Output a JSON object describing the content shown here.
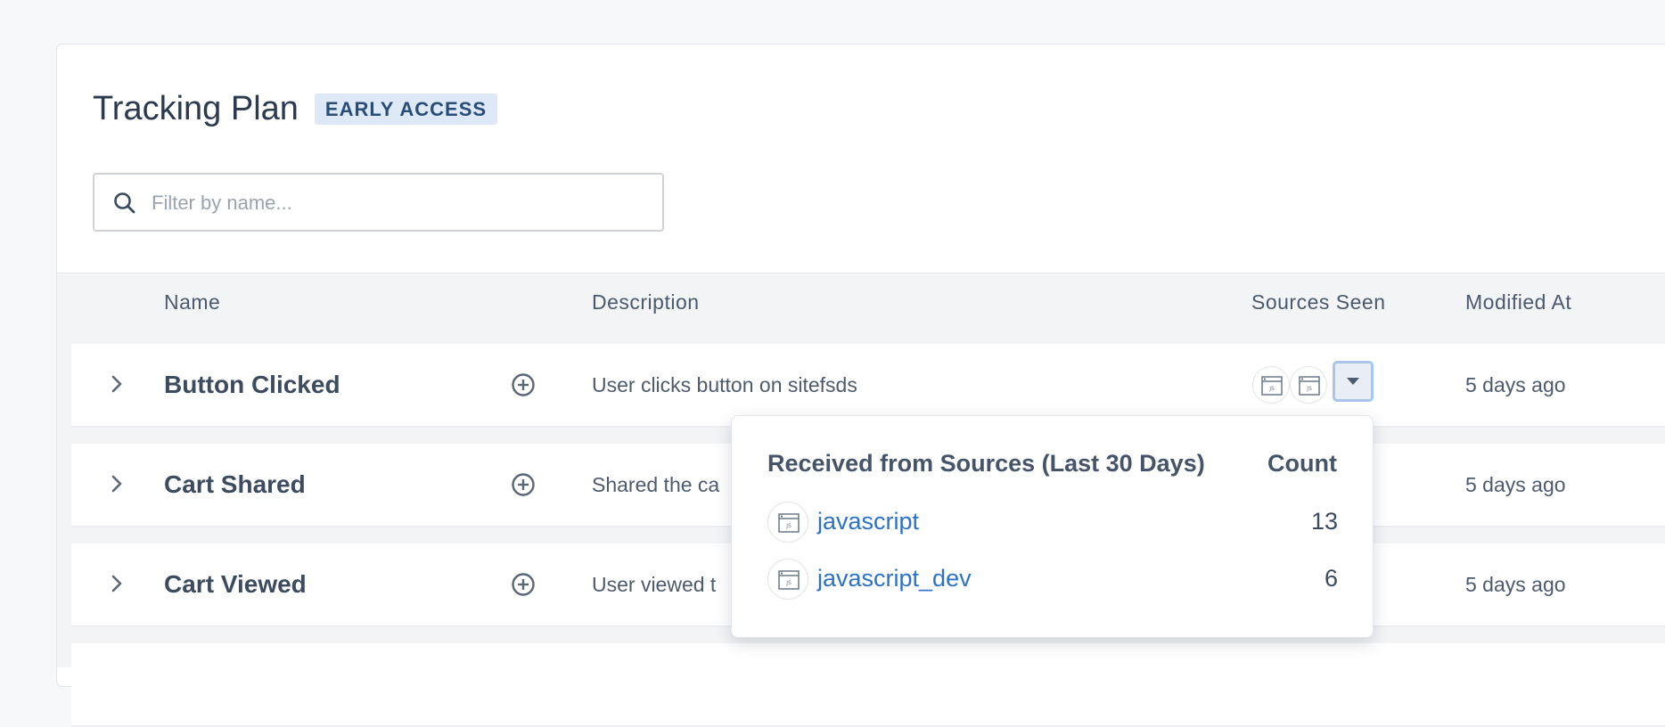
{
  "header": {
    "title": "Tracking Plan",
    "badge": "EARLY ACCESS"
  },
  "search": {
    "placeholder": "Filter by name...",
    "value": ""
  },
  "table": {
    "columns": [
      "Name",
      "Description",
      "Sources Seen",
      "Modified At"
    ],
    "rows": [
      {
        "name": "Button Clicked",
        "description": "User clicks button on sitefsds",
        "modified": "5 days ago",
        "source_icons": [
          "js-icon",
          "js-icon"
        ]
      },
      {
        "name": "Cart Shared",
        "description": "Shared the ca",
        "modified": "5 days ago"
      },
      {
        "name": "Cart Viewed",
        "description": "User viewed t",
        "modified": "5 days ago"
      }
    ]
  },
  "popover": {
    "title": "Received from Sources (Last 30 Days)",
    "count_label": "Count",
    "items": [
      {
        "name": "javascript",
        "count": "13",
        "icon": "js-icon"
      },
      {
        "name": "javascript_dev",
        "count": "6",
        "icon": "js-icon"
      }
    ]
  },
  "colors": {
    "link": "#2d72c6",
    "badge_bg": "#dde9f6",
    "badge_text": "#2a4d78",
    "dropdown_border": "#a9c6ea"
  }
}
